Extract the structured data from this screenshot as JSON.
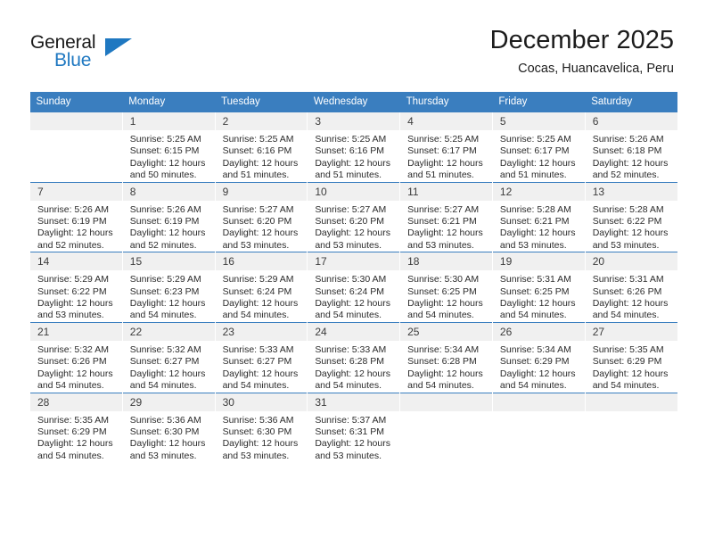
{
  "brand": {
    "name_top": "General",
    "name_bottom": "Blue",
    "color_accent": "#1f78c1"
  },
  "header": {
    "title": "December 2025",
    "subtitle": "Cocas, Huancavelica, Peru"
  },
  "theme": {
    "header_blue": "#3a7ebf",
    "daynum_band": "#f0f0f0",
    "text": "#2b2b2b"
  },
  "weekdays": [
    "Sunday",
    "Monday",
    "Tuesday",
    "Wednesday",
    "Thursday",
    "Friday",
    "Saturday"
  ],
  "labels": {
    "sunrise": "Sunrise:",
    "sunset": "Sunset:",
    "daylight": "Daylight:"
  },
  "weeks": [
    [
      {
        "day": "",
        "sunrise": "",
        "sunset": "",
        "daylight_1": "",
        "daylight_2": ""
      },
      {
        "day": "1",
        "sunrise": "Sunrise: 5:25 AM",
        "sunset": "Sunset: 6:15 PM",
        "daylight_1": "Daylight: 12 hours",
        "daylight_2": "and 50 minutes."
      },
      {
        "day": "2",
        "sunrise": "Sunrise: 5:25 AM",
        "sunset": "Sunset: 6:16 PM",
        "daylight_1": "Daylight: 12 hours",
        "daylight_2": "and 51 minutes."
      },
      {
        "day": "3",
        "sunrise": "Sunrise: 5:25 AM",
        "sunset": "Sunset: 6:16 PM",
        "daylight_1": "Daylight: 12 hours",
        "daylight_2": "and 51 minutes."
      },
      {
        "day": "4",
        "sunrise": "Sunrise: 5:25 AM",
        "sunset": "Sunset: 6:17 PM",
        "daylight_1": "Daylight: 12 hours",
        "daylight_2": "and 51 minutes."
      },
      {
        "day": "5",
        "sunrise": "Sunrise: 5:25 AM",
        "sunset": "Sunset: 6:17 PM",
        "daylight_1": "Daylight: 12 hours",
        "daylight_2": "and 51 minutes."
      },
      {
        "day": "6",
        "sunrise": "Sunrise: 5:26 AM",
        "sunset": "Sunset: 6:18 PM",
        "daylight_1": "Daylight: 12 hours",
        "daylight_2": "and 52 minutes."
      }
    ],
    [
      {
        "day": "7",
        "sunrise": "Sunrise: 5:26 AM",
        "sunset": "Sunset: 6:19 PM",
        "daylight_1": "Daylight: 12 hours",
        "daylight_2": "and 52 minutes."
      },
      {
        "day": "8",
        "sunrise": "Sunrise: 5:26 AM",
        "sunset": "Sunset: 6:19 PM",
        "daylight_1": "Daylight: 12 hours",
        "daylight_2": "and 52 minutes."
      },
      {
        "day": "9",
        "sunrise": "Sunrise: 5:27 AM",
        "sunset": "Sunset: 6:20 PM",
        "daylight_1": "Daylight: 12 hours",
        "daylight_2": "and 53 minutes."
      },
      {
        "day": "10",
        "sunrise": "Sunrise: 5:27 AM",
        "sunset": "Sunset: 6:20 PM",
        "daylight_1": "Daylight: 12 hours",
        "daylight_2": "and 53 minutes."
      },
      {
        "day": "11",
        "sunrise": "Sunrise: 5:27 AM",
        "sunset": "Sunset: 6:21 PM",
        "daylight_1": "Daylight: 12 hours",
        "daylight_2": "and 53 minutes."
      },
      {
        "day": "12",
        "sunrise": "Sunrise: 5:28 AM",
        "sunset": "Sunset: 6:21 PM",
        "daylight_1": "Daylight: 12 hours",
        "daylight_2": "and 53 minutes."
      },
      {
        "day": "13",
        "sunrise": "Sunrise: 5:28 AM",
        "sunset": "Sunset: 6:22 PM",
        "daylight_1": "Daylight: 12 hours",
        "daylight_2": "and 53 minutes."
      }
    ],
    [
      {
        "day": "14",
        "sunrise": "Sunrise: 5:29 AM",
        "sunset": "Sunset: 6:22 PM",
        "daylight_1": "Daylight: 12 hours",
        "daylight_2": "and 53 minutes."
      },
      {
        "day": "15",
        "sunrise": "Sunrise: 5:29 AM",
        "sunset": "Sunset: 6:23 PM",
        "daylight_1": "Daylight: 12 hours",
        "daylight_2": "and 54 minutes."
      },
      {
        "day": "16",
        "sunrise": "Sunrise: 5:29 AM",
        "sunset": "Sunset: 6:24 PM",
        "daylight_1": "Daylight: 12 hours",
        "daylight_2": "and 54 minutes."
      },
      {
        "day": "17",
        "sunrise": "Sunrise: 5:30 AM",
        "sunset": "Sunset: 6:24 PM",
        "daylight_1": "Daylight: 12 hours",
        "daylight_2": "and 54 minutes."
      },
      {
        "day": "18",
        "sunrise": "Sunrise: 5:30 AM",
        "sunset": "Sunset: 6:25 PM",
        "daylight_1": "Daylight: 12 hours",
        "daylight_2": "and 54 minutes."
      },
      {
        "day": "19",
        "sunrise": "Sunrise: 5:31 AM",
        "sunset": "Sunset: 6:25 PM",
        "daylight_1": "Daylight: 12 hours",
        "daylight_2": "and 54 minutes."
      },
      {
        "day": "20",
        "sunrise": "Sunrise: 5:31 AM",
        "sunset": "Sunset: 6:26 PM",
        "daylight_1": "Daylight: 12 hours",
        "daylight_2": "and 54 minutes."
      }
    ],
    [
      {
        "day": "21",
        "sunrise": "Sunrise: 5:32 AM",
        "sunset": "Sunset: 6:26 PM",
        "daylight_1": "Daylight: 12 hours",
        "daylight_2": "and 54 minutes."
      },
      {
        "day": "22",
        "sunrise": "Sunrise: 5:32 AM",
        "sunset": "Sunset: 6:27 PM",
        "daylight_1": "Daylight: 12 hours",
        "daylight_2": "and 54 minutes."
      },
      {
        "day": "23",
        "sunrise": "Sunrise: 5:33 AM",
        "sunset": "Sunset: 6:27 PM",
        "daylight_1": "Daylight: 12 hours",
        "daylight_2": "and 54 minutes."
      },
      {
        "day": "24",
        "sunrise": "Sunrise: 5:33 AM",
        "sunset": "Sunset: 6:28 PM",
        "daylight_1": "Daylight: 12 hours",
        "daylight_2": "and 54 minutes."
      },
      {
        "day": "25",
        "sunrise": "Sunrise: 5:34 AM",
        "sunset": "Sunset: 6:28 PM",
        "daylight_1": "Daylight: 12 hours",
        "daylight_2": "and 54 minutes."
      },
      {
        "day": "26",
        "sunrise": "Sunrise: 5:34 AM",
        "sunset": "Sunset: 6:29 PM",
        "daylight_1": "Daylight: 12 hours",
        "daylight_2": "and 54 minutes."
      },
      {
        "day": "27",
        "sunrise": "Sunrise: 5:35 AM",
        "sunset": "Sunset: 6:29 PM",
        "daylight_1": "Daylight: 12 hours",
        "daylight_2": "and 54 minutes."
      }
    ],
    [
      {
        "day": "28",
        "sunrise": "Sunrise: 5:35 AM",
        "sunset": "Sunset: 6:29 PM",
        "daylight_1": "Daylight: 12 hours",
        "daylight_2": "and 54 minutes."
      },
      {
        "day": "29",
        "sunrise": "Sunrise: 5:36 AM",
        "sunset": "Sunset: 6:30 PM",
        "daylight_1": "Daylight: 12 hours",
        "daylight_2": "and 53 minutes."
      },
      {
        "day": "30",
        "sunrise": "Sunrise: 5:36 AM",
        "sunset": "Sunset: 6:30 PM",
        "daylight_1": "Daylight: 12 hours",
        "daylight_2": "and 53 minutes."
      },
      {
        "day": "31",
        "sunrise": "Sunrise: 5:37 AM",
        "sunset": "Sunset: 6:31 PM",
        "daylight_1": "Daylight: 12 hours",
        "daylight_2": "and 53 minutes."
      },
      {
        "day": "",
        "sunrise": "",
        "sunset": "",
        "daylight_1": "",
        "daylight_2": ""
      },
      {
        "day": "",
        "sunrise": "",
        "sunset": "",
        "daylight_1": "",
        "daylight_2": ""
      },
      {
        "day": "",
        "sunrise": "",
        "sunset": "",
        "daylight_1": "",
        "daylight_2": ""
      }
    ]
  ]
}
